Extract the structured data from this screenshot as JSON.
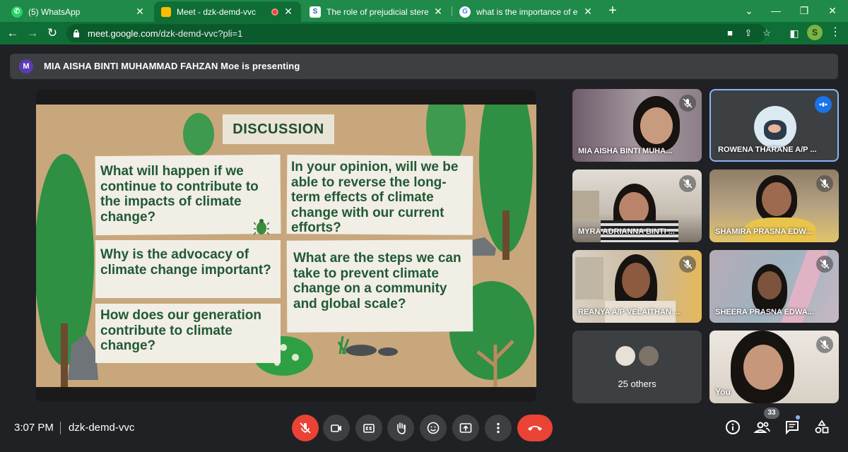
{
  "browser": {
    "tabs": [
      {
        "title": "(5) WhatsApp",
        "icon": "whatsapp-icon",
        "active": false
      },
      {
        "title": "Meet - dzk-demd-vvc",
        "icon": "meet-icon",
        "active": true
      },
      {
        "title": "The role of prejudicial stereotypes",
        "icon": "doc-icon",
        "active": false
      },
      {
        "title": "what is the importance of equality",
        "icon": "google-icon",
        "active": false
      }
    ],
    "url_domain": "meet.google.com",
    "url_path": "/dzk-demd-vvc?pli=1",
    "profile_initial": "S",
    "theme_color": "#1f8a49"
  },
  "presenting": {
    "avatar_initial": "M",
    "text": "MIA AISHA BINTI MUHAMMAD FAHZAN Moe is presenting"
  },
  "slide": {
    "heading": "DISCUSSION",
    "questions": [
      "What will happen if we continue to contribute to the impacts of climate change?",
      "In your opinion, will we be able to reverse the long-term effects of climate change with our current efforts?",
      "Why is the advocacy of climate change important?",
      "What are the steps we can take to prevent climate change on a community and global scale?",
      "How does our generation contribute to climate change?"
    ]
  },
  "participants": [
    {
      "name": "MIA AISHA BINTI MUHA...",
      "muted": true
    },
    {
      "name": "ROWENA THARANE A/P ...",
      "muted": false,
      "speaking": true
    },
    {
      "name": "MYRA ADRIANNA BINTI ...",
      "muted": true
    },
    {
      "name": "SHAMIRA PRASNA EDW...",
      "muted": true
    },
    {
      "name": "REANYA A/P VELAITHAN ...",
      "muted": true
    },
    {
      "name": "SHEERA PRASNA EDWA...",
      "muted": true
    },
    {
      "name": "25 others",
      "muted": false
    },
    {
      "name": "You",
      "muted": true
    }
  ],
  "bottom": {
    "time": "3:07 PM",
    "meeting_code": "dzk-demd-vvc",
    "people_count": "33"
  }
}
